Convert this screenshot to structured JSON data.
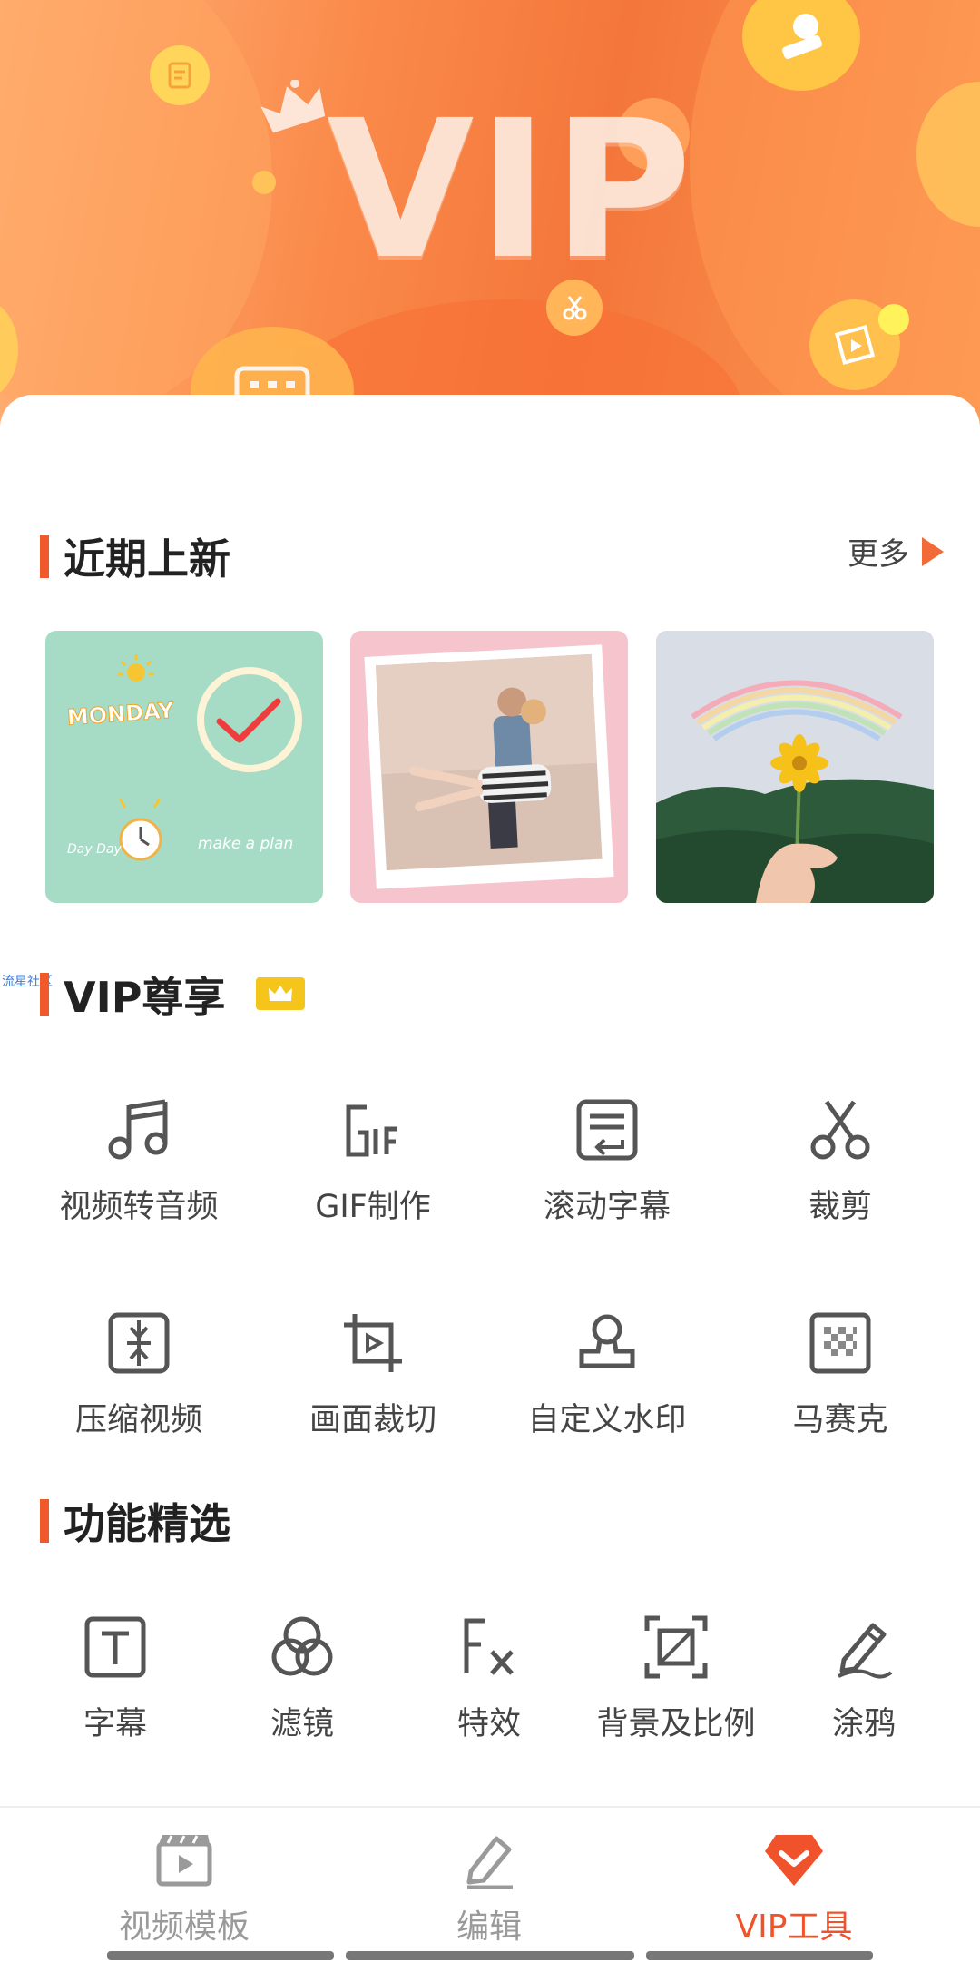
{
  "banner": {
    "title": "VIP",
    "colors": {
      "base": "#f4763a",
      "light": "#ffb37a"
    }
  },
  "side_tag": "流星社区",
  "recent": {
    "title": "近期上新",
    "more_label": "更多",
    "thumbnails": [
      {
        "name": "monday-plan",
        "text_a": "MONDAY",
        "text_b": "make a plan",
        "text_c": "Day Day"
      },
      {
        "name": "couple-photo"
      },
      {
        "name": "rainbow-flower"
      }
    ]
  },
  "vip_section": {
    "title": "VIP尊享",
    "tools": [
      {
        "label": "视频转音频",
        "icon": "music-note-icon"
      },
      {
        "label": "GIF制作",
        "icon": "gif-icon"
      },
      {
        "label": "滚动字幕",
        "icon": "scroll-caption-icon"
      },
      {
        "label": "裁剪",
        "icon": "scissors-icon"
      },
      {
        "label": "压缩视频",
        "icon": "compress-icon"
      },
      {
        "label": "画面裁切",
        "icon": "crop-icon"
      },
      {
        "label": "自定义水印",
        "icon": "stamp-icon"
      },
      {
        "label": "马赛克",
        "icon": "mosaic-icon"
      }
    ]
  },
  "features": {
    "title": "功能精选",
    "items": [
      {
        "label": "字幕",
        "icon": "text-icon"
      },
      {
        "label": "滤镜",
        "icon": "filter-icon"
      },
      {
        "label": "特效",
        "icon": "effects-icon"
      },
      {
        "label": "背景及比例",
        "icon": "aspect-ratio-icon"
      },
      {
        "label": "涂鸦",
        "icon": "pen-icon"
      }
    ]
  },
  "nav": {
    "items": [
      {
        "label": "视频模板",
        "icon": "video-template-icon",
        "active": false
      },
      {
        "label": "编辑",
        "icon": "edit-icon",
        "active": false
      },
      {
        "label": "VIP工具",
        "icon": "vip-tool-icon",
        "active": true
      }
    ],
    "active_color": "#f0532b",
    "inactive_color": "#9a9a9a"
  }
}
